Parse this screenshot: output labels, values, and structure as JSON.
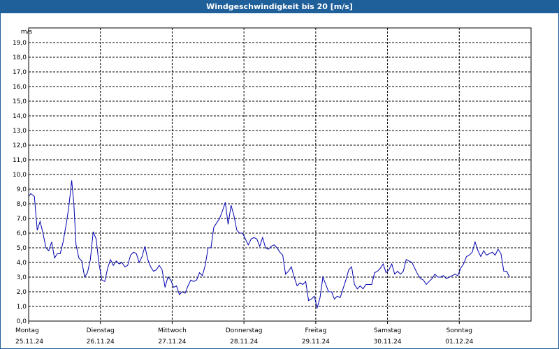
{
  "window": {
    "title": "Windgeschwindigkeit bis 20 [m/s]"
  },
  "chart_data": {
    "type": "line",
    "title": "Windgeschwindigkeit bis 20 [m/s]",
    "ylabel": "m/s",
    "xlabel": "",
    "ylim": [
      0,
      20
    ],
    "xlim": [
      0,
      7
    ],
    "grid": true,
    "yticks": [
      "0,0",
      "1,0",
      "2,0",
      "3,0",
      "4,0",
      "5,0",
      "6,0",
      "7,0",
      "8,0",
      "9,0",
      "10,0",
      "11,0",
      "12,0",
      "13,0",
      "14,0",
      "15,0",
      "16,0",
      "17,0",
      "18,0",
      "19,0"
    ],
    "xticks": [
      {
        "day": "Montag",
        "date": "25.11.24"
      },
      {
        "day": "Dienstag",
        "date": "26.11.24"
      },
      {
        "day": "Mittwoch",
        "date": "27.11.24"
      },
      {
        "day": "Donnerstag",
        "date": "28.11.24"
      },
      {
        "day": "Freitag",
        "date": "29.11.24"
      },
      {
        "day": "Samstag",
        "date": "30.11.24"
      },
      {
        "day": "Sonntag",
        "date": "01.12.24"
      }
    ],
    "line_color": "#0000b0",
    "series": [
      {
        "values": [
          [
            0.0,
            8.5
          ],
          [
            0.03,
            8.7
          ],
          [
            0.08,
            8.5
          ],
          [
            0.12,
            6.2
          ],
          [
            0.16,
            6.8
          ],
          [
            0.2,
            6.0
          ],
          [
            0.24,
            5.0
          ],
          [
            0.28,
            4.8
          ],
          [
            0.32,
            5.4
          ],
          [
            0.36,
            4.3
          ],
          [
            0.4,
            4.6
          ],
          [
            0.44,
            4.6
          ],
          [
            0.48,
            5.4
          ],
          [
            0.53,
            6.8
          ],
          [
            0.56,
            7.8
          ],
          [
            0.6,
            9.6
          ],
          [
            0.63,
            8.0
          ],
          [
            0.66,
            5.2
          ],
          [
            0.7,
            4.3
          ],
          [
            0.74,
            4.1
          ],
          [
            0.78,
            3.0
          ],
          [
            0.82,
            3.3
          ],
          [
            0.86,
            4.2
          ],
          [
            0.9,
            6.1
          ],
          [
            0.94,
            5.6
          ],
          [
            0.98,
            3.9
          ],
          [
            1.02,
            2.8
          ],
          [
            1.06,
            2.7
          ],
          [
            1.1,
            3.6
          ],
          [
            1.14,
            4.2
          ],
          [
            1.18,
            3.8
          ],
          [
            1.22,
            4.1
          ],
          [
            1.26,
            3.9
          ],
          [
            1.3,
            4.0
          ],
          [
            1.34,
            3.7
          ],
          [
            1.38,
            3.8
          ],
          [
            1.42,
            4.5
          ],
          [
            1.46,
            4.7
          ],
          [
            1.5,
            4.6
          ],
          [
            1.54,
            4.0
          ],
          [
            1.58,
            4.4
          ],
          [
            1.62,
            5.1
          ],
          [
            1.66,
            4.2
          ],
          [
            1.7,
            3.7
          ],
          [
            1.74,
            3.4
          ],
          [
            1.78,
            3.5
          ],
          [
            1.82,
            3.8
          ],
          [
            1.86,
            3.5
          ],
          [
            1.9,
            2.3
          ],
          [
            1.94,
            3.0
          ],
          [
            1.98,
            2.8
          ],
          [
            2.02,
            2.3
          ],
          [
            2.06,
            2.4
          ],
          [
            2.1,
            1.8
          ],
          [
            2.14,
            2.0
          ],
          [
            2.18,
            1.9
          ],
          [
            2.22,
            2.4
          ],
          [
            2.26,
            2.8
          ],
          [
            2.3,
            2.7
          ],
          [
            2.34,
            2.8
          ],
          [
            2.38,
            3.3
          ],
          [
            2.42,
            3.1
          ],
          [
            2.46,
            3.8
          ],
          [
            2.5,
            5.0
          ],
          [
            2.54,
            5.0
          ],
          [
            2.58,
            6.4
          ],
          [
            2.62,
            6.7
          ],
          [
            2.66,
            7.0
          ],
          [
            2.7,
            7.5
          ],
          [
            2.74,
            8.1
          ],
          [
            2.78,
            6.6
          ],
          [
            2.82,
            7.9
          ],
          [
            2.86,
            7.2
          ],
          [
            2.9,
            6.2
          ],
          [
            2.94,
            6.0
          ],
          [
            2.98,
            6.0
          ],
          [
            3.02,
            5.6
          ],
          [
            3.06,
            5.2
          ],
          [
            3.1,
            5.6
          ],
          [
            3.14,
            5.7
          ],
          [
            3.18,
            5.6
          ],
          [
            3.22,
            5.1
          ],
          [
            3.26,
            5.7
          ],
          [
            3.3,
            5.0
          ],
          [
            3.34,
            4.9
          ],
          [
            3.38,
            5.1
          ],
          [
            3.42,
            5.2
          ],
          [
            3.46,
            5.0
          ],
          [
            3.5,
            4.7
          ],
          [
            3.54,
            4.5
          ],
          [
            3.58,
            3.2
          ],
          [
            3.62,
            3.4
          ],
          [
            3.66,
            3.7
          ],
          [
            3.7,
            3.0
          ],
          [
            3.74,
            2.4
          ],
          [
            3.78,
            2.6
          ],
          [
            3.82,
            2.5
          ],
          [
            3.86,
            2.7
          ],
          [
            3.9,
            1.4
          ],
          [
            3.94,
            1.5
          ],
          [
            3.98,
            1.7
          ],
          [
            4.02,
            0.9
          ],
          [
            4.06,
            1.6
          ],
          [
            4.1,
            3.0
          ],
          [
            4.14,
            2.5
          ],
          [
            4.18,
            2.0
          ],
          [
            4.22,
            2.0
          ],
          [
            4.26,
            1.5
          ],
          [
            4.3,
            1.7
          ],
          [
            4.34,
            1.6
          ],
          [
            4.38,
            2.2
          ],
          [
            4.42,
            2.8
          ],
          [
            4.46,
            3.5
          ],
          [
            4.5,
            3.7
          ],
          [
            4.54,
            2.5
          ],
          [
            4.58,
            2.2
          ],
          [
            4.62,
            2.4
          ],
          [
            4.66,
            2.2
          ],
          [
            4.7,
            2.5
          ],
          [
            4.74,
            2.5
          ],
          [
            4.78,
            2.5
          ],
          [
            4.82,
            3.3
          ],
          [
            4.86,
            3.4
          ],
          [
            4.9,
            3.6
          ],
          [
            4.94,
            3.9
          ],
          [
            4.98,
            3.3
          ],
          [
            5.02,
            3.5
          ],
          [
            5.06,
            3.9
          ],
          [
            5.1,
            3.2
          ],
          [
            5.14,
            3.4
          ],
          [
            5.18,
            3.2
          ],
          [
            5.22,
            3.4
          ],
          [
            5.26,
            4.2
          ],
          [
            5.3,
            4.1
          ],
          [
            5.34,
            4.0
          ],
          [
            5.38,
            3.6
          ],
          [
            5.42,
            3.2
          ],
          [
            5.46,
            2.9
          ],
          [
            5.5,
            2.8
          ],
          [
            5.54,
            2.5
          ],
          [
            5.58,
            2.7
          ],
          [
            5.62,
            2.9
          ],
          [
            5.66,
            3.2
          ],
          [
            5.7,
            3.0
          ],
          [
            5.74,
            3.0
          ],
          [
            5.78,
            3.1
          ],
          [
            5.82,
            2.9
          ],
          [
            5.86,
            3.0
          ],
          [
            5.9,
            3.1
          ],
          [
            5.94,
            3.2
          ],
          [
            5.98,
            3.1
          ],
          [
            6.02,
            3.6
          ],
          [
            6.06,
            3.9
          ],
          [
            6.1,
            4.4
          ],
          [
            6.14,
            4.5
          ],
          [
            6.18,
            4.7
          ],
          [
            6.22,
            5.4
          ],
          [
            6.26,
            4.8
          ],
          [
            6.3,
            4.4
          ],
          [
            6.34,
            4.8
          ],
          [
            6.38,
            4.5
          ],
          [
            6.42,
            4.6
          ],
          [
            6.46,
            4.7
          ],
          [
            6.5,
            4.5
          ],
          [
            6.54,
            4.9
          ],
          [
            6.58,
            4.6
          ],
          [
            6.62,
            3.4
          ],
          [
            6.66,
            3.4
          ],
          [
            6.7,
            3.0
          ]
        ]
      }
    ]
  }
}
